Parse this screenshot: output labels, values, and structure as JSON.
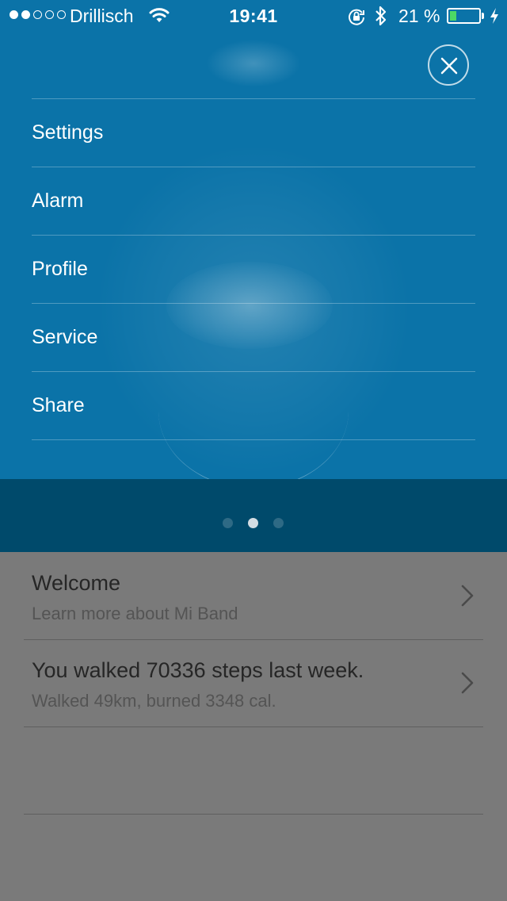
{
  "status_bar": {
    "carrier": "Drillisch",
    "time": "19:41",
    "battery_text": "21 %",
    "battery_level": 0.21,
    "signal_strength": 2,
    "signal_max": 5,
    "icons": [
      "signal-dots-icon",
      "wifi-icon",
      "rotation-lock-icon",
      "bluetooth-icon",
      "battery-icon",
      "charging-bolt-icon"
    ]
  },
  "menu": {
    "close_icon": "close-icon",
    "items": [
      {
        "label": "Settings"
      },
      {
        "label": "Alarm"
      },
      {
        "label": "Profile"
      },
      {
        "label": "Service"
      },
      {
        "label": "Share"
      }
    ]
  },
  "pager": {
    "count": 3,
    "active_index": 1
  },
  "feed": {
    "cards": [
      {
        "title": "Welcome",
        "subtitle": "Learn more about Mi Band",
        "icon": "chevron-right-icon"
      },
      {
        "title": "You walked 70336 steps last week.",
        "subtitle": "Walked 49km, burned 3348 cal.",
        "icon": "chevron-right-icon"
      }
    ]
  },
  "colors": {
    "menu_background": "#0b73a8",
    "pager_band": "#004a6b",
    "dim_overlay": "#7a7a7a",
    "battery_fill": "#4cd964",
    "text_on_blue": "#ffffff"
  }
}
